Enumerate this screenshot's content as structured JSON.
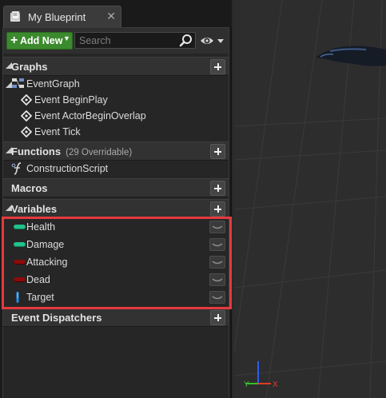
{
  "tab": {
    "title": "My Blueprint",
    "close": "✕"
  },
  "toolbar": {
    "add_new_label": "Add New",
    "search_placeholder": "Search",
    "search_value": ""
  },
  "sections": {
    "graphs": {
      "title": "Graphs",
      "items": [
        {
          "label": "EventGraph",
          "icon": "event-graph-icon"
        },
        {
          "label": "Event BeginPlay",
          "icon": "event-node-icon"
        },
        {
          "label": "Event ActorBeginOverlap",
          "icon": "event-node-icon"
        },
        {
          "label": "Event Tick",
          "icon": "event-node-icon"
        }
      ]
    },
    "functions": {
      "title": "Functions",
      "subtitle": "(29 Overridable)",
      "items": [
        {
          "label": "ConstructionScript",
          "icon": "function-icon"
        }
      ]
    },
    "macros": {
      "title": "Macros"
    },
    "variables": {
      "title": "Variables",
      "items": [
        {
          "label": "Health",
          "type": "float",
          "color": "#21c38a"
        },
        {
          "label": "Damage",
          "type": "float",
          "color": "#21c38a"
        },
        {
          "label": "Attacking",
          "type": "bool",
          "color": "#8c0b0b"
        },
        {
          "label": "Dead",
          "type": "bool",
          "color": "#8c0b0b"
        },
        {
          "label": "Target",
          "type": "object",
          "color": "#1c8fe0"
        }
      ]
    },
    "event_dispatchers": {
      "title": "Event Dispatchers"
    }
  },
  "viewport": {
    "gizmo": {
      "x_label": "X",
      "y_label": "Y",
      "x_color": "#e03a2a",
      "y_color": "#39c02a",
      "z_color": "#2a5cf0"
    }
  },
  "colors": {
    "highlight": "#e43a3f",
    "add_new": "#3c8a2e"
  }
}
